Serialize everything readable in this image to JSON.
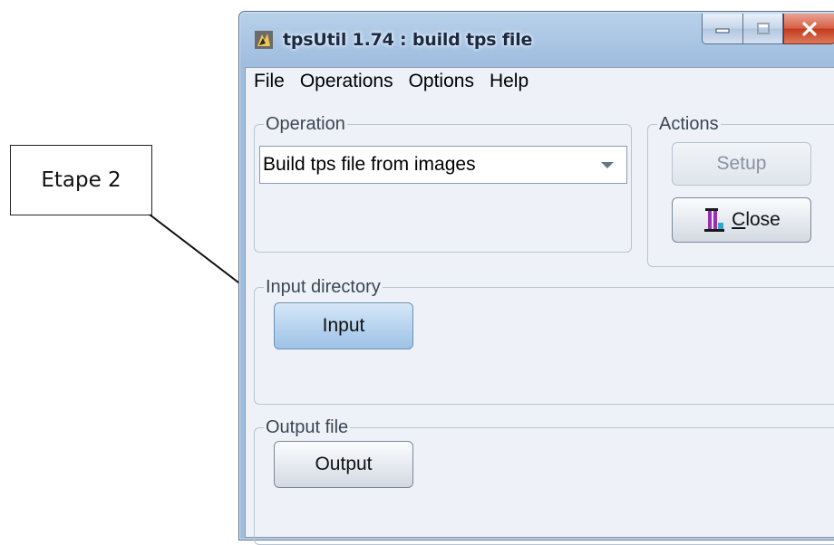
{
  "annotation": {
    "label": "Etape 2"
  },
  "window": {
    "title": "tpsUtil 1.74 : build tps file",
    "controls": [
      "minimize-icon",
      "maximize-icon",
      "close-icon"
    ]
  },
  "menu": {
    "items": [
      "File",
      "Operations",
      "Options",
      "Help"
    ]
  },
  "operation": {
    "legend": "Operation",
    "selected": "Build tps file from images"
  },
  "actions": {
    "legend": "Actions",
    "setup_label": "Setup",
    "close_label_mnemonic": "C",
    "close_label_rest": "lose"
  },
  "input_directory": {
    "legend": "Input directory",
    "button_label": "Input"
  },
  "output_file": {
    "legend": "Output file",
    "button_label": "Output"
  },
  "colors": {
    "titlebar": "#a7c3e2",
    "client_bg": "#eef2f8",
    "close_button": "#c2391d",
    "input_button": "#b5d2ee"
  }
}
